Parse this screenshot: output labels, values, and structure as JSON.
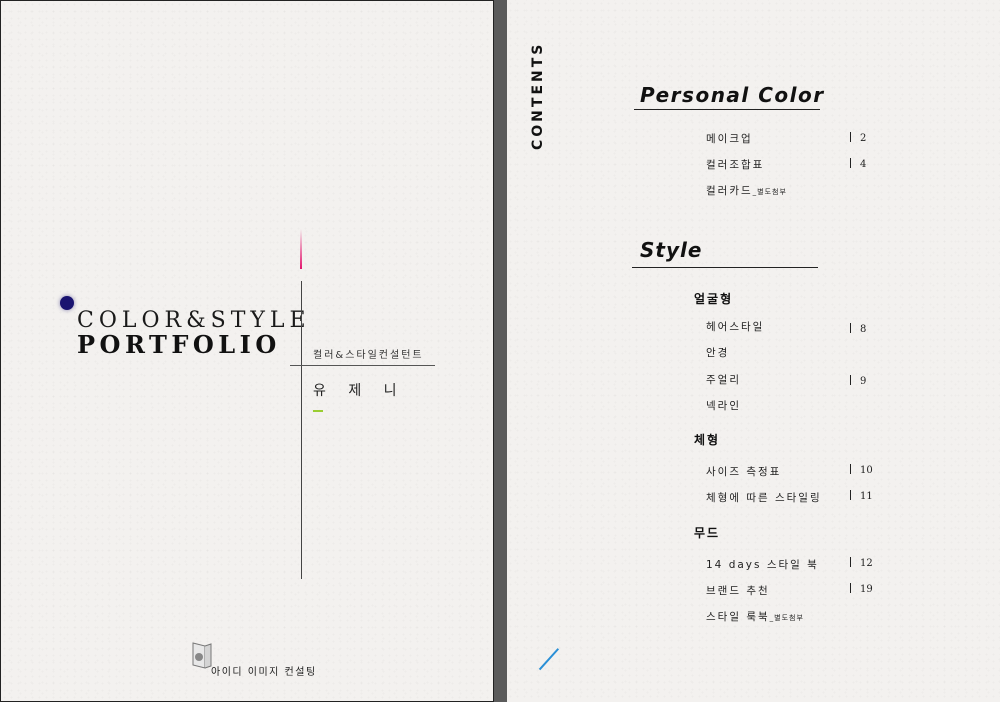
{
  "cover": {
    "title_line1": "COLOR&STYLE",
    "title_line2": "PORTFOLIO",
    "subtitle": "컬러&스타일컨설턴트",
    "name": "유 제 니",
    "company": "아이디 이미지 컨설팅",
    "accent_color": "#1a1470"
  },
  "toc": {
    "heading": "CONTENTS",
    "section_personal_color": "Personal Color",
    "personal_color_items": [
      {
        "label": "메이크업",
        "page": "2"
      },
      {
        "label": "컬러조합표",
        "page": "4"
      },
      {
        "label": "컬러카드",
        "suffix": "_별도첨부",
        "page": ""
      }
    ],
    "section_style": "Style",
    "category_face": "얼굴형",
    "face_items": [
      {
        "label": "헤어스타일",
        "page": "8"
      },
      {
        "label": "안경",
        "page": ""
      },
      {
        "label": "주얼리",
        "page": "9"
      },
      {
        "label": "넥라인",
        "page": ""
      }
    ],
    "category_body": "체형",
    "body_items": [
      {
        "label": "사이즈 측정표",
        "page": "10"
      },
      {
        "label": "체형에 따른 스타일링",
        "page": "11"
      }
    ],
    "category_mood": "무드",
    "mood_items": [
      {
        "label": "14 days 스타일 북",
        "page": "12"
      },
      {
        "label": "브랜드 추천",
        "page": "19"
      },
      {
        "label": "스타일 룩북",
        "suffix": "_별도첨부",
        "page": ""
      }
    ]
  }
}
